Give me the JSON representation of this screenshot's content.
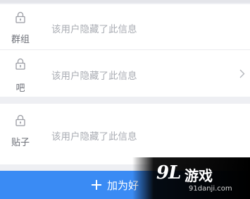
{
  "rows": [
    {
      "label": "群组",
      "info": "该用户隐藏了此信息",
      "icon": "lock-icon",
      "has_chevron": false
    },
    {
      "label": "吧",
      "info": "该用户隐藏了此信息",
      "icon": "lock-icon",
      "has_chevron": true
    },
    {
      "label": "贴子",
      "info": "该用户隐藏了此信息",
      "icon": "lock-icon",
      "has_chevron": false
    }
  ],
  "add_button": {
    "label": "加为好",
    "icon": "plus-icon"
  },
  "watermark": {
    "mark": "9L",
    "name": "游戏",
    "url": "91danji.com"
  },
  "colors": {
    "accent": "#3a8bf4",
    "background": "#eeeff3",
    "card": "#ffffff",
    "muted_text": "#a9acb3",
    "label_text": "#6b6e76"
  }
}
